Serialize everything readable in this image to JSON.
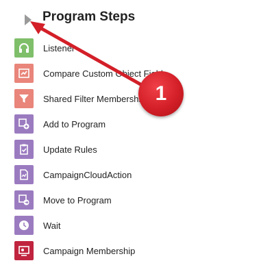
{
  "panel": {
    "title": "Program Steps",
    "items": [
      {
        "label": "Listener",
        "icon": "headphones-icon",
        "color": "#7fbf6a"
      },
      {
        "label": "Compare Custom Object Fields",
        "icon": "compare-icon",
        "color": "#e9857a"
      },
      {
        "label": "Shared Filter Membership",
        "icon": "filter-icon",
        "color": "#e9857a"
      },
      {
        "label": "Add to Program",
        "icon": "add-to-program-icon",
        "color": "#9b7bc0"
      },
      {
        "label": "Update Rules",
        "icon": "clipboard-icon",
        "color": "#9b7bc0"
      },
      {
        "label": "CampaignCloudAction",
        "icon": "document-icon",
        "color": "#9b7bc0"
      },
      {
        "label": "Move to Program",
        "icon": "move-icon",
        "color": "#9b7bc0"
      },
      {
        "label": "Wait",
        "icon": "clock-icon",
        "color": "#9b7bc0"
      },
      {
        "label": "Campaign Membership",
        "icon": "membership-icon",
        "color": "#c0243f"
      }
    ]
  },
  "annotation": {
    "number": "1",
    "color": "#d31f28"
  }
}
